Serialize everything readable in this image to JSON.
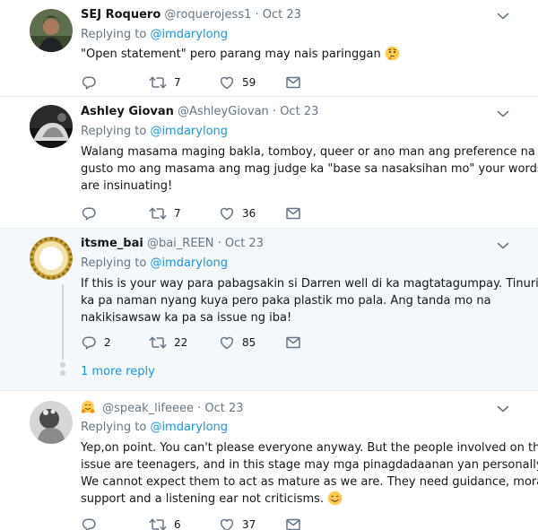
{
  "tweets": [
    {
      "name": "SEJ Roquero",
      "handle": "@roquerojess1",
      "date": "Oct 23",
      "replying_prefix": "Replying to",
      "replying_to": "@imdarylong",
      "lines": [
        "\"Open statement\" pero parang may nais paringgan"
      ],
      "emoji": "thinking-face-emoji",
      "reply_count": "",
      "retweet_count": "7",
      "like_count": "59"
    },
    {
      "name": "Ashley Giovan",
      "handle": "@AshleyGiovan",
      "date": "Oct 23",
      "replying_prefix": "Replying to",
      "replying_to": "@imdarylong",
      "lines": [
        "Walang masama maging bakla, tomboy, queer or ano man ang preference na",
        "gusto mo ang masama ang mag judge ka \"base sa nasaksihan mo\" your words",
        "are insinuating!"
      ],
      "reply_count": "",
      "retweet_count": "7",
      "like_count": "36"
    },
    {
      "name": "itsme_bai",
      "handle": "@bai_REEN",
      "date": "Oct 23",
      "replying_prefix": "Replying to",
      "replying_to": "@imdarylong",
      "lines": [
        "If this is your way para pabagsakin si Darren well di ka magtatagumpay. Tinuring",
        "ka pa naman nyang kuya pero paka plastik mo pala. Ang tanda mo na",
        "nakikisawsaw ka pa sa issue ng iba!"
      ],
      "reply_count": "2",
      "retweet_count": "22",
      "like_count": "85",
      "more_reply": "1 more reply"
    },
    {
      "name": "",
      "name_emoji": "hugging-face-emoji",
      "handle": "@speak_lifeeee",
      "date": "Oct 23",
      "replying_prefix": "Replying to",
      "replying_to": "@imdarylong",
      "lines": [
        "Yep,on point. You can't please everyone anyway. But the people involved on this",
        "issue are teenagers, and in this stage may mga pinagdadaanan yan personally.",
        "We cannot expect them to act as mature as we are. They need guidance, moral",
        "support and a listening ear not criticisms."
      ],
      "emoji": "smiling-face-emoji",
      "reply_count": "",
      "retweet_count": "6",
      "like_count": "37"
    }
  ],
  "separator": "·",
  "colors": {
    "link": "#1b95e0",
    "muted": "#657786",
    "text": "#14171a",
    "highlight_bg": "#f5f8fa",
    "border": "#e6ecf0"
  }
}
